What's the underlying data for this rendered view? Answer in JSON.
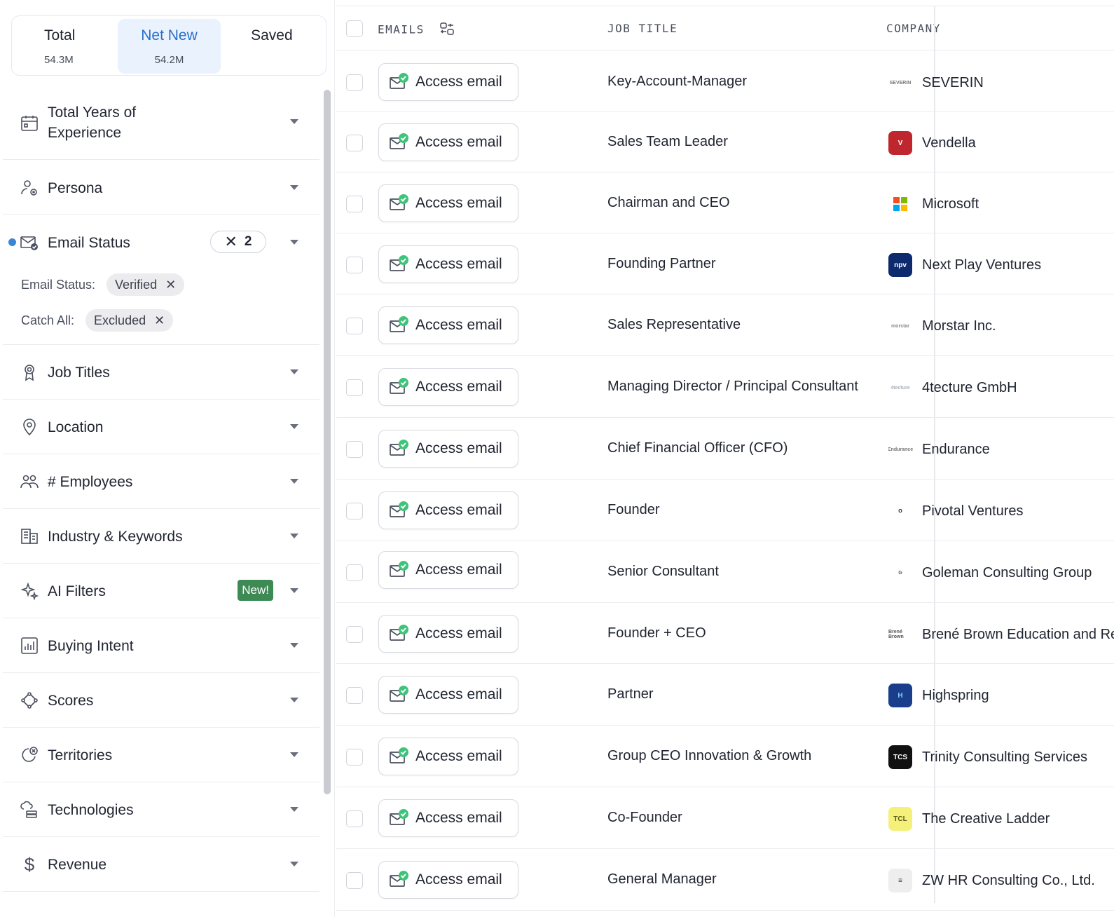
{
  "tabs": [
    {
      "label": "Total",
      "value": "54.3M"
    },
    {
      "label": "Net New",
      "value": "54.2M"
    },
    {
      "label": "Saved",
      "value": ""
    }
  ],
  "filters": {
    "years": "Total Years of Experience",
    "persona": "Persona",
    "email_status": "Email Status",
    "email_status_count": "2",
    "email_status_sub_label": "Email Status:",
    "email_status_sub_value": "Verified",
    "catch_all_label": "Catch All:",
    "catch_all_value": "Excluded",
    "job_titles": "Job Titles",
    "location": "Location",
    "employees": "# Employees",
    "industry": "Industry & Keywords",
    "ai_filters": "AI Filters",
    "ai_badge": "New!",
    "buying_intent": "Buying Intent",
    "scores": "Scores",
    "territories": "Territories",
    "technologies": "Technologies",
    "revenue": "Revenue"
  },
  "table": {
    "col_emails": "EMAILS",
    "col_job": "JOB TITLE",
    "col_company": "COMPANY",
    "access_label": "Access email",
    "rows": [
      {
        "job": "Key-Account-Manager",
        "company": "SEVERIN",
        "logo": "SEVERIN",
        "logo_bg": "#ffffff",
        "logo_fg": "#777777"
      },
      {
        "job": "Sales Team Leader",
        "company": "Vendella",
        "logo": "V",
        "logo_bg": "#c0262d",
        "logo_fg": "#ffffff"
      },
      {
        "job": "Chairman and CEO",
        "company": "Microsoft",
        "logo": "",
        "logo_bg": "#ffffff",
        "logo_fg": "#000000"
      },
      {
        "job": "Founding Partner",
        "company": "Next Play Ventures",
        "logo": "npv",
        "logo_bg": "#0d2a6e",
        "logo_fg": "#ffffff"
      },
      {
        "job": "Sales Representative",
        "company": "Morstar Inc.",
        "logo": "morstar",
        "logo_bg": "#ffffff",
        "logo_fg": "#888888"
      },
      {
        "job": "Managing Director / Principal Consultant",
        "company": "4tecture GmbH",
        "logo": "4tecture",
        "logo_bg": "#ffffff",
        "logo_fg": "#aab0bb"
      },
      {
        "job": "Chief Financial Officer (CFO)",
        "company": "Endurance",
        "logo": "Endurance",
        "logo_bg": "#ffffff",
        "logo_fg": "#777777"
      },
      {
        "job": "Founder",
        "company": "Pivotal Ventures",
        "logo": "O",
        "logo_bg": "#ffffff",
        "logo_fg": "#111111"
      },
      {
        "job": "Senior Consultant",
        "company": "Goleman Consulting Group",
        "logo": "G",
        "logo_bg": "#ffffff",
        "logo_fg": "#555555"
      },
      {
        "job": "Founder + CEO",
        "company": "Brené Brown Education and Research Group",
        "logo": "Brené Brown",
        "logo_bg": "#ffffff",
        "logo_fg": "#555555"
      },
      {
        "job": "Partner",
        "company": "Highspring",
        "logo": "H",
        "logo_bg": "#1a3e8c",
        "logo_fg": "#7fd1ff"
      },
      {
        "job": "Group CEO Innovation & Growth",
        "company": "Trinity Consulting Services",
        "logo": "TCS",
        "logo_bg": "#111111",
        "logo_fg": "#ffffff"
      },
      {
        "job": "Co-Founder",
        "company": "The Creative Ladder",
        "logo": "TCL",
        "logo_bg": "#f5f07a",
        "logo_fg": "#5a5a1a"
      },
      {
        "job": "General Manager",
        "company": "ZW HR Consulting Co., Ltd.",
        "logo": "≡",
        "logo_bg": "#eeeeee",
        "logo_fg": "#333333"
      }
    ]
  },
  "colors": {
    "accent": "#2a6fc9",
    "verified_green": "#3ec47a",
    "new_badge": "#3d8a55"
  }
}
